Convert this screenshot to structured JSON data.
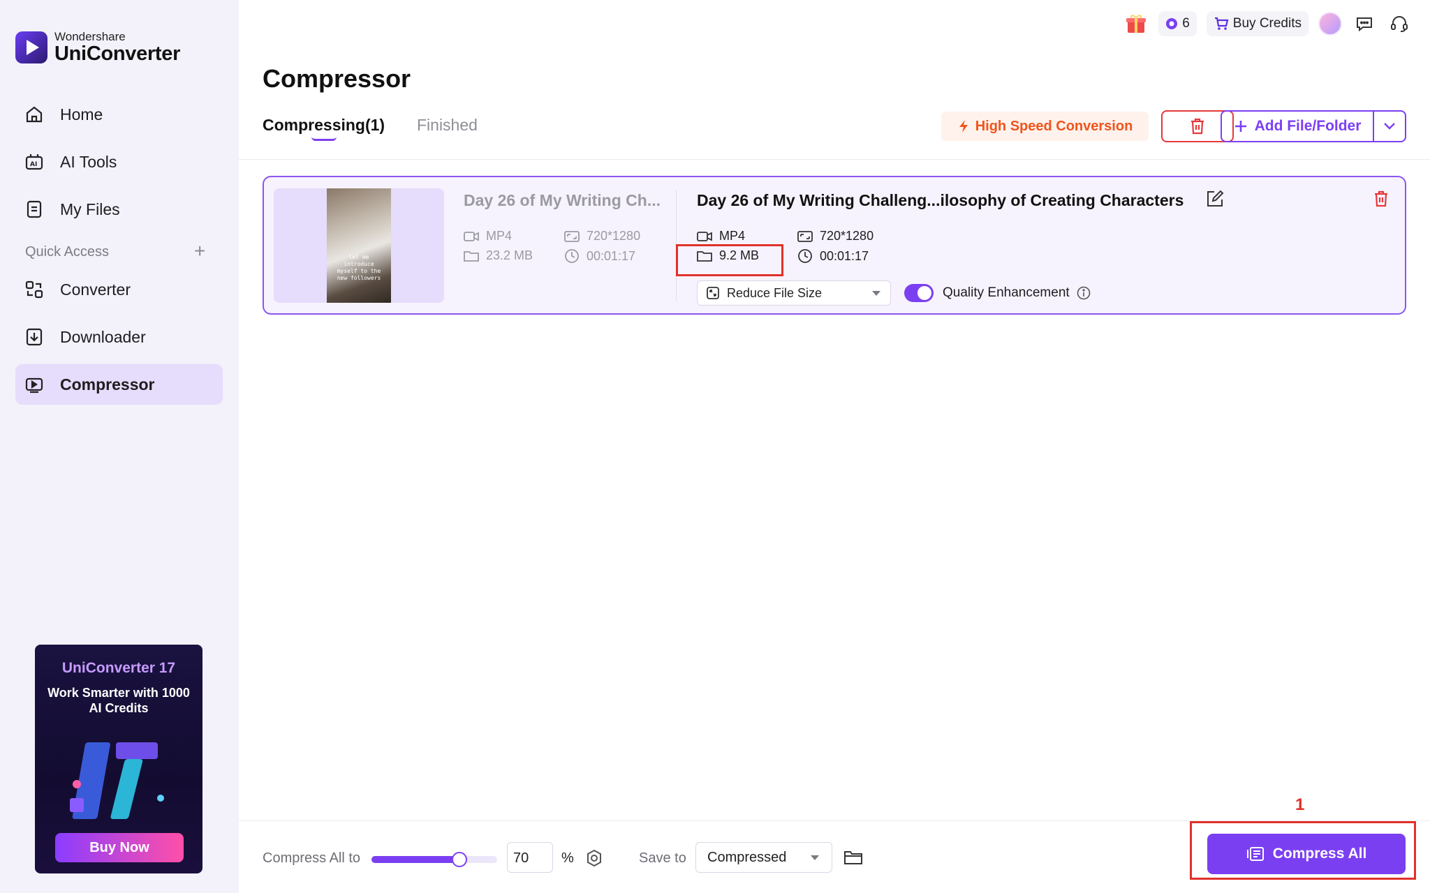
{
  "app": {
    "brand": "Wondershare",
    "product": "UniConverter"
  },
  "sidebar": {
    "items": [
      {
        "label": "Home",
        "icon": "home-icon"
      },
      {
        "label": "AI Tools",
        "icon": "ai-tools-icon"
      },
      {
        "label": "My Files",
        "icon": "file-icon"
      }
    ],
    "quick_access_title": "Quick Access",
    "quick_access_items": [
      {
        "label": "Converter",
        "icon": "converter-icon"
      },
      {
        "label": "Downloader",
        "icon": "downloader-icon"
      },
      {
        "label": "Compressor",
        "icon": "compressor-icon",
        "active": true
      }
    ],
    "promo": {
      "title": "UniConverter 17",
      "subtitle": "Work Smarter with 1000 AI Credits",
      "button": "Buy Now"
    }
  },
  "topbar": {
    "credits_count": "6",
    "buy_credits": "Buy Credits"
  },
  "page": {
    "title": "Compressor",
    "tabs": [
      {
        "label": "Compressing(1)",
        "active": true
      },
      {
        "label": "Finished",
        "active": false
      }
    ],
    "high_speed_label": "High Speed Conversion",
    "add_file_label": "Add File/Folder"
  },
  "file": {
    "source": {
      "title": "Day 26 of My Writing Ch...",
      "format": "MP4",
      "resolution": "720*1280",
      "size": "23.2 MB",
      "duration": "00:01:17"
    },
    "output": {
      "title": "Day 26 of My Writing Challeng...ilosophy of Creating Characters",
      "format": "MP4",
      "resolution": "720*1280",
      "size": "9.2 MB",
      "duration": "00:01:17"
    },
    "thumbnail_caption": "let me introduce myself to the new followers",
    "preset": "Reduce File Size",
    "quality_enhancement_label": "Quality Enhancement",
    "quality_enhancement_on": true
  },
  "bottom": {
    "compress_all_to_label": "Compress All to",
    "percent_value": "70",
    "percent_unit": "%",
    "slider_fraction": 0.7,
    "save_to_label": "Save to",
    "save_to_value": "Compressed",
    "compress_all_label": "Compress All",
    "annotation_number": "1"
  },
  "colors": {
    "accent": "#7b3ff2",
    "danger": "#e5383b",
    "warning": "#f0541d"
  }
}
